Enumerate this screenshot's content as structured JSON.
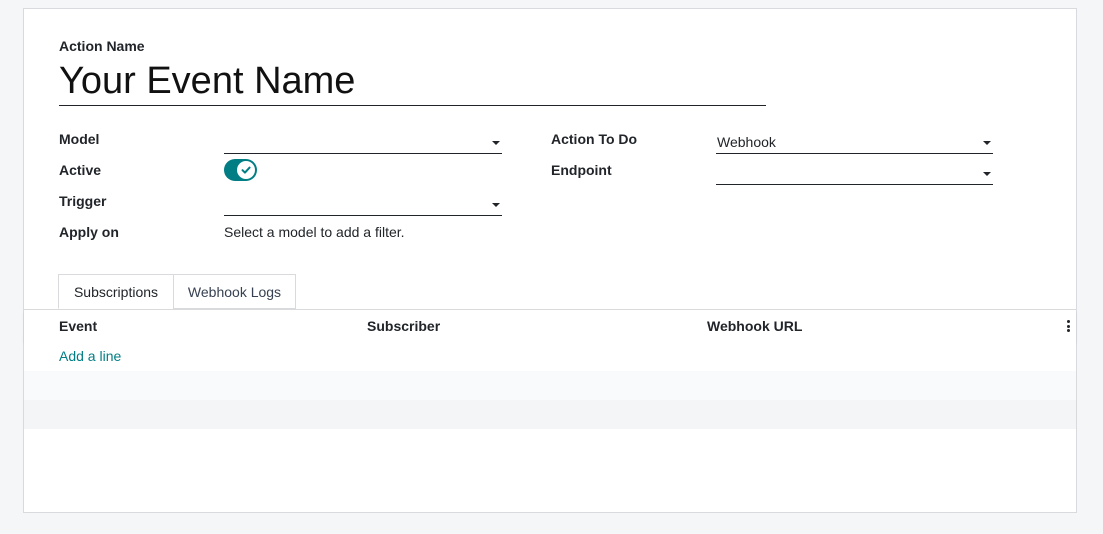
{
  "form": {
    "action_name_label": "Action Name",
    "action_name_value": "Your Event Name",
    "fields": {
      "model": {
        "label": "Model",
        "value": ""
      },
      "active": {
        "label": "Active",
        "checked": true
      },
      "trigger": {
        "label": "Trigger",
        "value": ""
      },
      "apply_on": {
        "label": "Apply on",
        "value": "Select a model to add a filter."
      },
      "action_to_do": {
        "label": "Action To Do",
        "value": "Webhook"
      },
      "endpoint": {
        "label": "Endpoint",
        "value": ""
      }
    }
  },
  "tabs": [
    {
      "label": "Subscriptions",
      "active": true
    },
    {
      "label": "Webhook Logs",
      "active": false
    }
  ],
  "table": {
    "columns": [
      "Event",
      "Subscriber",
      "Webhook URL"
    ],
    "add_line_label": "Add a line"
  },
  "colors": {
    "accent": "#017e84",
    "border": "#d8dadd"
  }
}
